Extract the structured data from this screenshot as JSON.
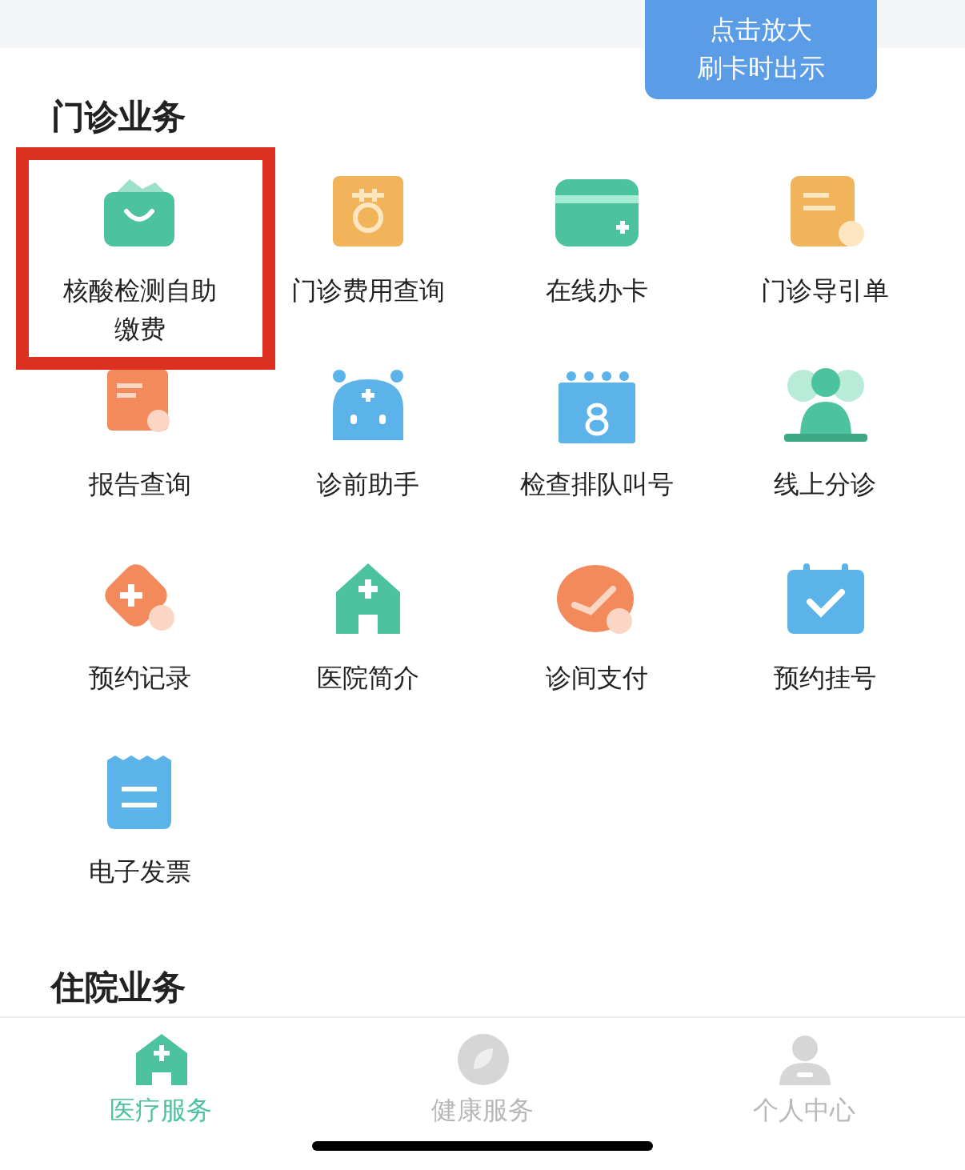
{
  "float_button": {
    "lines": [
      "点击放大",
      "刷卡时出示"
    ]
  },
  "sections": [
    {
      "title": "门诊业务",
      "items": [
        {
          "label": "核酸检测自助缴费",
          "highlighted": true
        },
        {
          "label": "门诊费用查询",
          "highlighted": false
        },
        {
          "label": "在线办卡",
          "highlighted": false
        },
        {
          "label": "门诊导引单",
          "highlighted": false
        },
        {
          "label": "报告查询",
          "highlighted": false
        },
        {
          "label": "诊前助手",
          "highlighted": false
        },
        {
          "label": "检查排队叫号",
          "highlighted": false
        },
        {
          "label": "线上分诊",
          "highlighted": false
        },
        {
          "label": "预约记录",
          "highlighted": false
        },
        {
          "label": "医院简介",
          "highlighted": false
        },
        {
          "label": "诊间支付",
          "highlighted": false
        },
        {
          "label": "预约挂号",
          "highlighted": false
        },
        {
          "label": "电子发票",
          "highlighted": false
        }
      ]
    },
    {
      "title": "住院业务"
    }
  ],
  "tabs": [
    {
      "label": "医疗服务",
      "selected": true
    },
    {
      "label": "健康服务",
      "selected": false
    },
    {
      "label": "个人中心",
      "selected": false
    }
  ]
}
